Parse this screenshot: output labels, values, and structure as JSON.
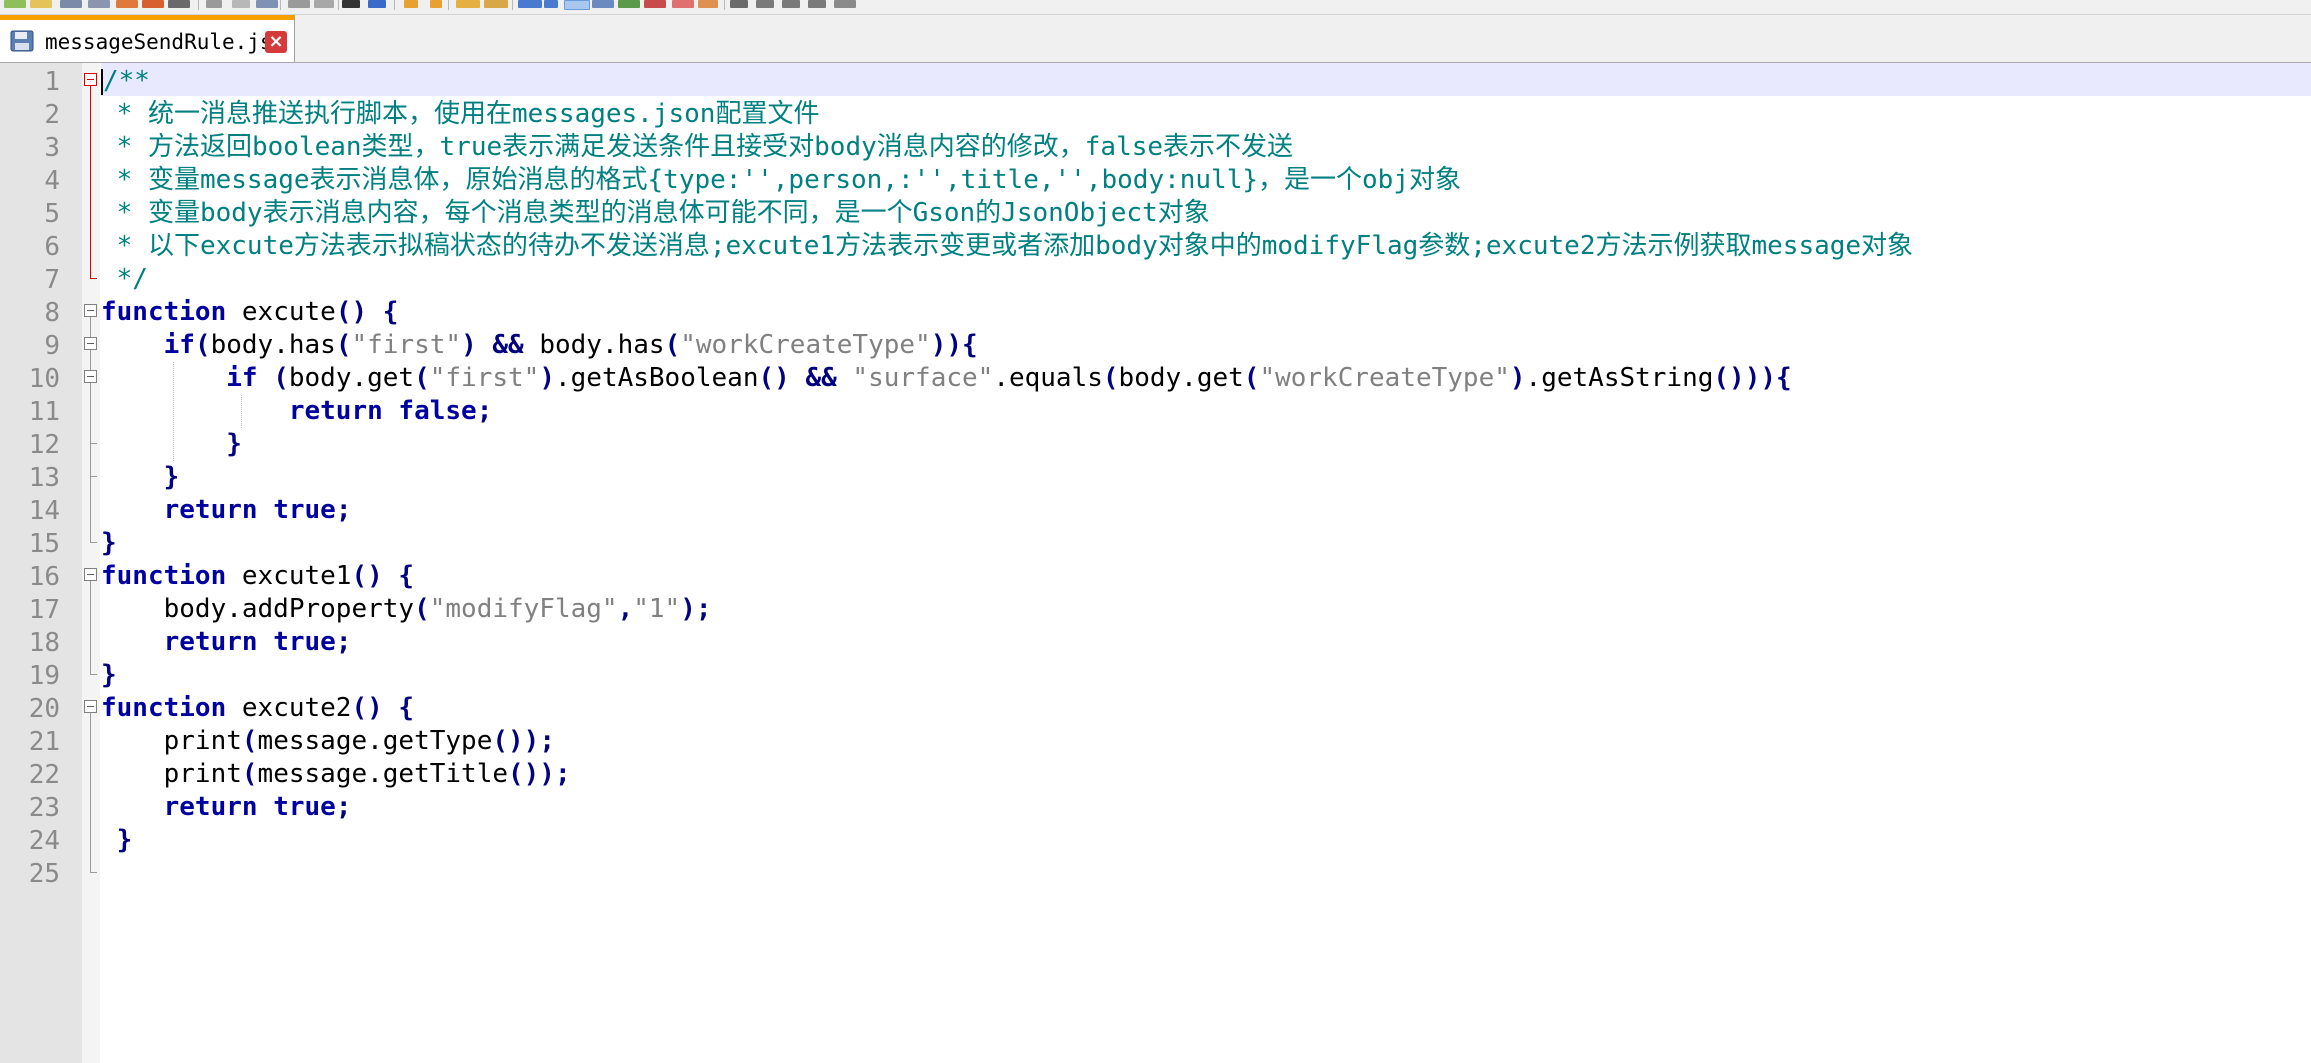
{
  "tab": {
    "filename": "messageSendRule.js",
    "close_glyph": "×"
  },
  "editor": {
    "line_numbers": [
      "1",
      "2",
      "3",
      "4",
      "5",
      "6",
      "7",
      "8",
      "9",
      "10",
      "11",
      "12",
      "13",
      "14",
      "15",
      "16",
      "17",
      "18",
      "19",
      "20",
      "21",
      "22",
      "23",
      "24",
      "25"
    ],
    "lines": [
      [
        {
          "t": "/**",
          "c": "cm"
        }
      ],
      [
        {
          "t": " * 统一消息推送执行脚本，使用在messages.json配置文件",
          "c": "cm"
        }
      ],
      [
        {
          "t": " * 方法返回boolean类型，true表示满足发送条件且接受对body消息内容的修改，false表示不发送",
          "c": "cm"
        }
      ],
      [
        {
          "t": " * 变量message表示消息体，原始消息的格式{type:'',person,:'',title,'',body:null}，是一个obj对象",
          "c": "cm"
        }
      ],
      [
        {
          "t": " * 变量body表示消息内容，每个消息类型的消息体可能不同，是一个Gson的JsonObject对象",
          "c": "cm"
        }
      ],
      [
        {
          "t": " * 以下excute方法表示拟稿状态的待办不发送消息;excute1方法表示变更或者添加body对象中的modifyFlag参数;excute2方法示例获取message对象",
          "c": "cm"
        }
      ],
      [
        {
          "t": " */",
          "c": "cm"
        }
      ],
      [
        {
          "t": "function",
          "c": "kw"
        },
        {
          "t": " excute",
          "c": ""
        },
        {
          "t": "()",
          "c": "op"
        },
        {
          "t": " {",
          "c": "op"
        }
      ],
      [
        {
          "t": "    ",
          "c": ""
        },
        {
          "t": "if",
          "c": "kw"
        },
        {
          "t": "(",
          "c": "op"
        },
        {
          "t": "body.has",
          "c": ""
        },
        {
          "t": "(",
          "c": "op"
        },
        {
          "t": "\"first\"",
          "c": "st"
        },
        {
          "t": ")",
          "c": "op"
        },
        {
          "t": " ",
          "c": ""
        },
        {
          "t": "&&",
          "c": "op"
        },
        {
          "t": " body.has",
          "c": ""
        },
        {
          "t": "(",
          "c": "op"
        },
        {
          "t": "\"workCreateType\"",
          "c": "st"
        },
        {
          "t": ")){",
          "c": "op"
        }
      ],
      [
        {
          "t": "        ",
          "c": ""
        },
        {
          "t": "if",
          "c": "kw"
        },
        {
          "t": " ",
          "c": ""
        },
        {
          "t": "(",
          "c": "op"
        },
        {
          "t": "body.get",
          "c": ""
        },
        {
          "t": "(",
          "c": "op"
        },
        {
          "t": "\"first\"",
          "c": "st"
        },
        {
          "t": ")",
          "c": "op"
        },
        {
          "t": ".getAsBoolean",
          "c": ""
        },
        {
          "t": "()",
          "c": "op"
        },
        {
          "t": " ",
          "c": ""
        },
        {
          "t": "&&",
          "c": "op"
        },
        {
          "t": " ",
          "c": ""
        },
        {
          "t": "\"surface\"",
          "c": "st"
        },
        {
          "t": ".equals",
          "c": ""
        },
        {
          "t": "(",
          "c": "op"
        },
        {
          "t": "body.get",
          "c": ""
        },
        {
          "t": "(",
          "c": "op"
        },
        {
          "t": "\"workCreateType\"",
          "c": "st"
        },
        {
          "t": ")",
          "c": "op"
        },
        {
          "t": ".getAsString",
          "c": ""
        },
        {
          "t": "())){",
          "c": "op"
        }
      ],
      [
        {
          "t": "            ",
          "c": ""
        },
        {
          "t": "return",
          "c": "kw"
        },
        {
          "t": " ",
          "c": ""
        },
        {
          "t": "false",
          "c": "kw"
        },
        {
          "t": ";",
          "c": "op"
        }
      ],
      [
        {
          "t": "        ",
          "c": ""
        },
        {
          "t": "}",
          "c": "op"
        }
      ],
      [
        {
          "t": "    ",
          "c": ""
        },
        {
          "t": "}",
          "c": "op"
        }
      ],
      [
        {
          "t": "    ",
          "c": ""
        },
        {
          "t": "return",
          "c": "kw"
        },
        {
          "t": " ",
          "c": ""
        },
        {
          "t": "true",
          "c": "kw"
        },
        {
          "t": ";",
          "c": "op"
        }
      ],
      [
        {
          "t": "}",
          "c": "op"
        }
      ],
      [
        {
          "t": "function",
          "c": "kw"
        },
        {
          "t": " excute1",
          "c": ""
        },
        {
          "t": "()",
          "c": "op"
        },
        {
          "t": " {",
          "c": "op"
        }
      ],
      [
        {
          "t": "    body.addProperty",
          "c": ""
        },
        {
          "t": "(",
          "c": "op"
        },
        {
          "t": "\"modifyFlag\"",
          "c": "st"
        },
        {
          "t": ",",
          "c": "op"
        },
        {
          "t": "\"1\"",
          "c": "st"
        },
        {
          "t": ");",
          "c": "op"
        }
      ],
      [
        {
          "t": "    ",
          "c": ""
        },
        {
          "t": "return",
          "c": "kw"
        },
        {
          "t": " ",
          "c": ""
        },
        {
          "t": "true",
          "c": "kw"
        },
        {
          "t": ";",
          "c": "op"
        }
      ],
      [
        {
          "t": "}",
          "c": "op"
        }
      ],
      [
        {
          "t": "function",
          "c": "kw"
        },
        {
          "t": " excute2",
          "c": ""
        },
        {
          "t": "()",
          "c": "op"
        },
        {
          "t": " {",
          "c": "op"
        }
      ],
      [
        {
          "t": "    print",
          "c": ""
        },
        {
          "t": "(",
          "c": "op"
        },
        {
          "t": "message.getType",
          "c": ""
        },
        {
          "t": "());",
          "c": "op"
        }
      ],
      [
        {
          "t": "    print",
          "c": ""
        },
        {
          "t": "(",
          "c": "op"
        },
        {
          "t": "message.getTitle",
          "c": ""
        },
        {
          "t": "());",
          "c": "op"
        }
      ],
      [
        {
          "t": "    ",
          "c": ""
        },
        {
          "t": "return",
          "c": "kw"
        },
        {
          "t": " ",
          "c": ""
        },
        {
          "t": "true",
          "c": "kw"
        },
        {
          "t": ";",
          "c": "op"
        }
      ],
      [
        {
          "t": " }",
          "c": "op"
        }
      ],
      []
    ]
  },
  "colors": {
    "comment": "#008080",
    "keyword": "#0000a0",
    "operator": "#000080",
    "string": "#808080",
    "current_line": "#e8e8ff",
    "tab_accent": "#f5a000"
  }
}
